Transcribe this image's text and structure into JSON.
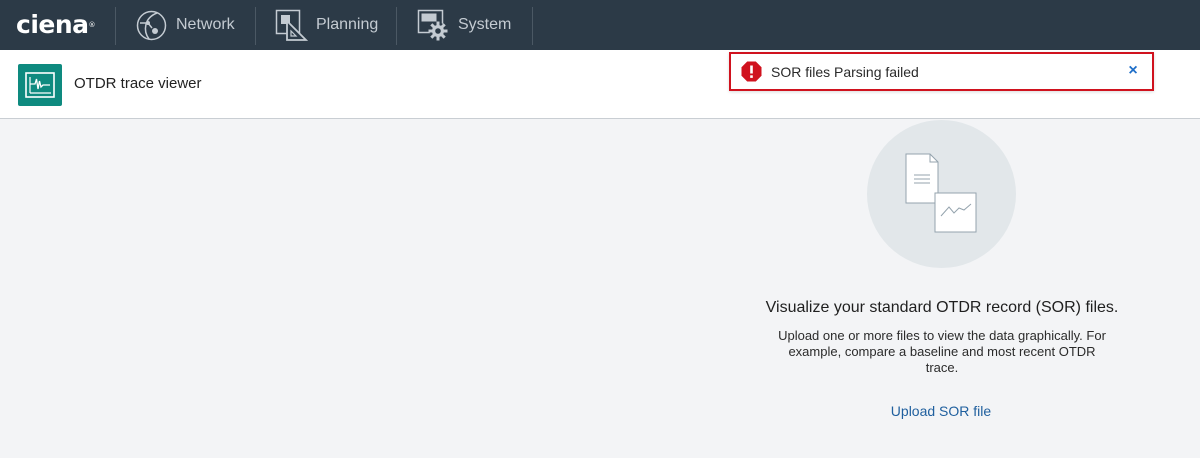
{
  "nav": {
    "brand": "ciena",
    "items": [
      {
        "label": "Network",
        "icon": "globe-icon"
      },
      {
        "label": "Planning",
        "icon": "planning-ruler-icon"
      },
      {
        "label": "System",
        "icon": "system-gear-icon"
      }
    ]
  },
  "app": {
    "title": "OTDR trace viewer",
    "icon": "otdr-trace-icon",
    "accent_color": "#0e8a7f"
  },
  "toast": {
    "message": "SOR files Parsing failed",
    "close_label": "×",
    "icon": "error-alert-icon",
    "border_color": "#d0121e"
  },
  "empty_state": {
    "illustration": "files-chart-illustration-icon",
    "headline": "Visualize your standard OTDR record (SOR) files.",
    "description": "Upload one or more files to view the data graphically. For example, compare a baseline and most recent OTDR trace.",
    "upload_label": "Upload SOR file"
  }
}
